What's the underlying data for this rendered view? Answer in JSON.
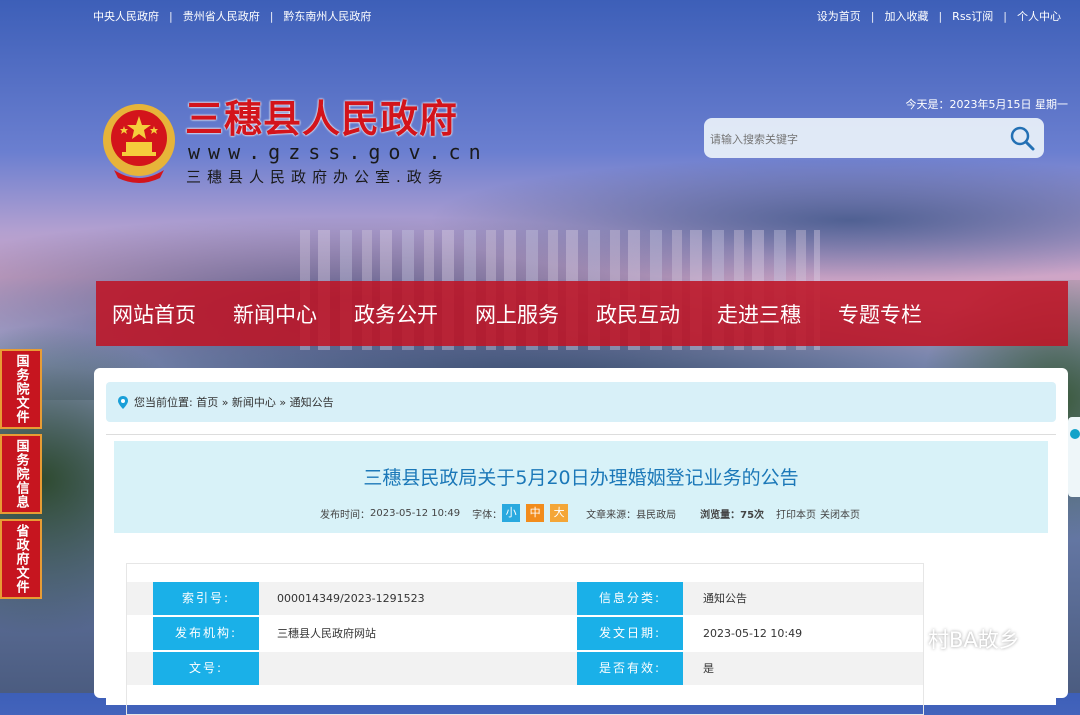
{
  "topbar": {
    "left_links": [
      "中央人民政府",
      "贵州省人民政府",
      "黔东南州人民政府"
    ],
    "right_links": [
      "设为首页",
      "加入收藏",
      "Rss订阅",
      "个人中心"
    ],
    "separator": "|"
  },
  "header": {
    "title": "三穗县人民政府",
    "url": "www.gzss.gov.cn",
    "subtitle": "三穗县人民政府办公室.政务",
    "date": "今天是：2023年5月15日 星期一",
    "search_placeholder": "请输入搜索关键字"
  },
  "nav": {
    "items": [
      "网站首页",
      "新闻中心",
      "政务公开",
      "网上服务",
      "政民互动",
      "走进三穗",
      "专题专栏"
    ]
  },
  "side_tabs": [
    "国务院文件",
    "国务院信息",
    "省政府文件"
  ],
  "breadcrumb": {
    "text": "您当前位置: 首页 » 新闻中心 » 通知公告"
  },
  "article": {
    "title": "三穗县民政局关于5月20日办理婚姻登记业务的公告",
    "publish_label": "发布时间：",
    "publish_time": "2023-05-12 10:49",
    "font_label": "字体：",
    "font_small": "小",
    "font_medium": "中",
    "font_large": "大",
    "source_label": "文章来源：",
    "source": "县民政局",
    "views_label": "浏览量：",
    "views": "75次",
    "print_link": "打印本页",
    "close_link": "关闭本页"
  },
  "info_table": {
    "rows": [
      {
        "label1": "索引号:",
        "value1": "000014349/2023-1291523",
        "label2": "信息分类:",
        "value2": "通知公告"
      },
      {
        "label1": "发布机构:",
        "value1": "三穗县人民政府网站",
        "label2": "发文日期:",
        "value2": "2023-05-12 10:49"
      },
      {
        "label1": "文号:",
        "value1": "",
        "label2": "是否有效:",
        "value2": "是"
      }
    ]
  },
  "watermark": "村BA故乡",
  "colors": {
    "title_red": "#d3141b",
    "nav_red": "#be1426",
    "label_blue": "#1ab0e8",
    "article_title_blue": "#1b78b8"
  }
}
